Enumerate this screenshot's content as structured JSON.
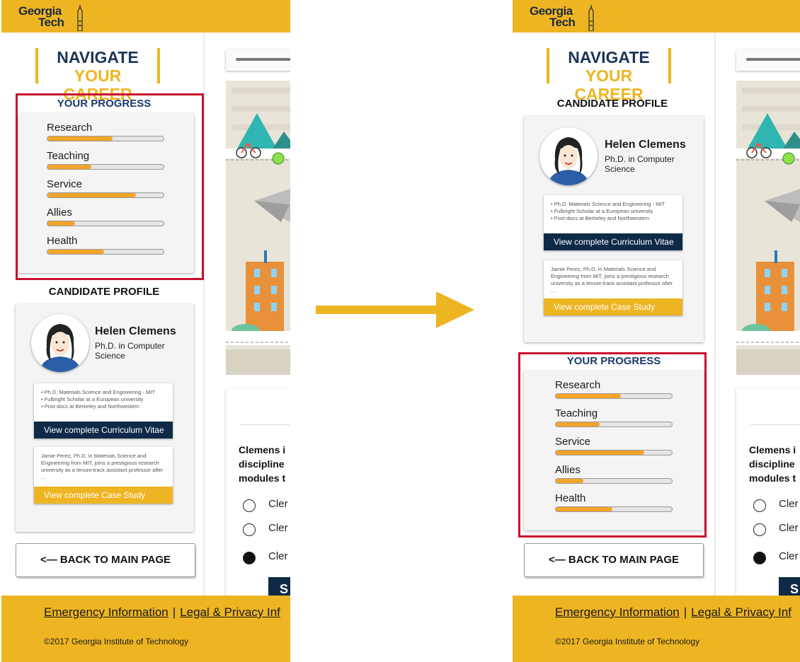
{
  "header": {
    "logo_line1": "Georgia",
    "logo_line2": "Tech"
  },
  "sidebar": {
    "title_line1": "NAVIGATE",
    "title_line2": "YOUR CAREER",
    "progress_heading": "YOUR PROGRESS",
    "profile_heading": "CANDIDATE PROFILE",
    "progress": [
      {
        "label": "Research",
        "value": 0.56
      },
      {
        "label": "Teaching",
        "value": 0.38
      },
      {
        "label": "Service",
        "value": 0.76
      },
      {
        "label": "Allies",
        "value": 0.24
      },
      {
        "label": "Health",
        "value": 0.49
      }
    ],
    "candidate": {
      "name": "Helen Clemens",
      "degree": "Ph.D. in Computer Science",
      "cv_bullets": [
        "• Ph.D. Materials Science and Engineering - MIT",
        "• Fulbright Scholar at a European university",
        "• Post-docs at Berkeley and Northwestern"
      ],
      "cv_button": "View complete Curriculum Vitae",
      "case_text": "Jamie Perez, Ph.D. in Materials Science and Engineering from MIT, joins a prestigious research university as a tenure-track assistant professor after ...",
      "case_button": "View complete Case Study"
    },
    "back_button": "<— BACK TO MAIN PAGE"
  },
  "content": {
    "question_lines": [
      "Clemens i",
      "discipline",
      "modules t"
    ],
    "options": [
      {
        "label": "Cler",
        "checked": false
      },
      {
        "label": "Cler",
        "checked": false
      },
      {
        "label": "Cler",
        "checked": true
      }
    ],
    "submit_label": "S"
  },
  "footer": {
    "link1": "Emergency Information",
    "separator": "|",
    "link2": "Legal & Privacy Inf",
    "copyright": "©2017 Georgia Institute of Technology"
  },
  "colors": {
    "gold": "#EEB523",
    "navy": "#0f2a47",
    "progress_fill": "#F2A52A",
    "highlight": "#C8102E",
    "arrow": "#EEB523"
  }
}
